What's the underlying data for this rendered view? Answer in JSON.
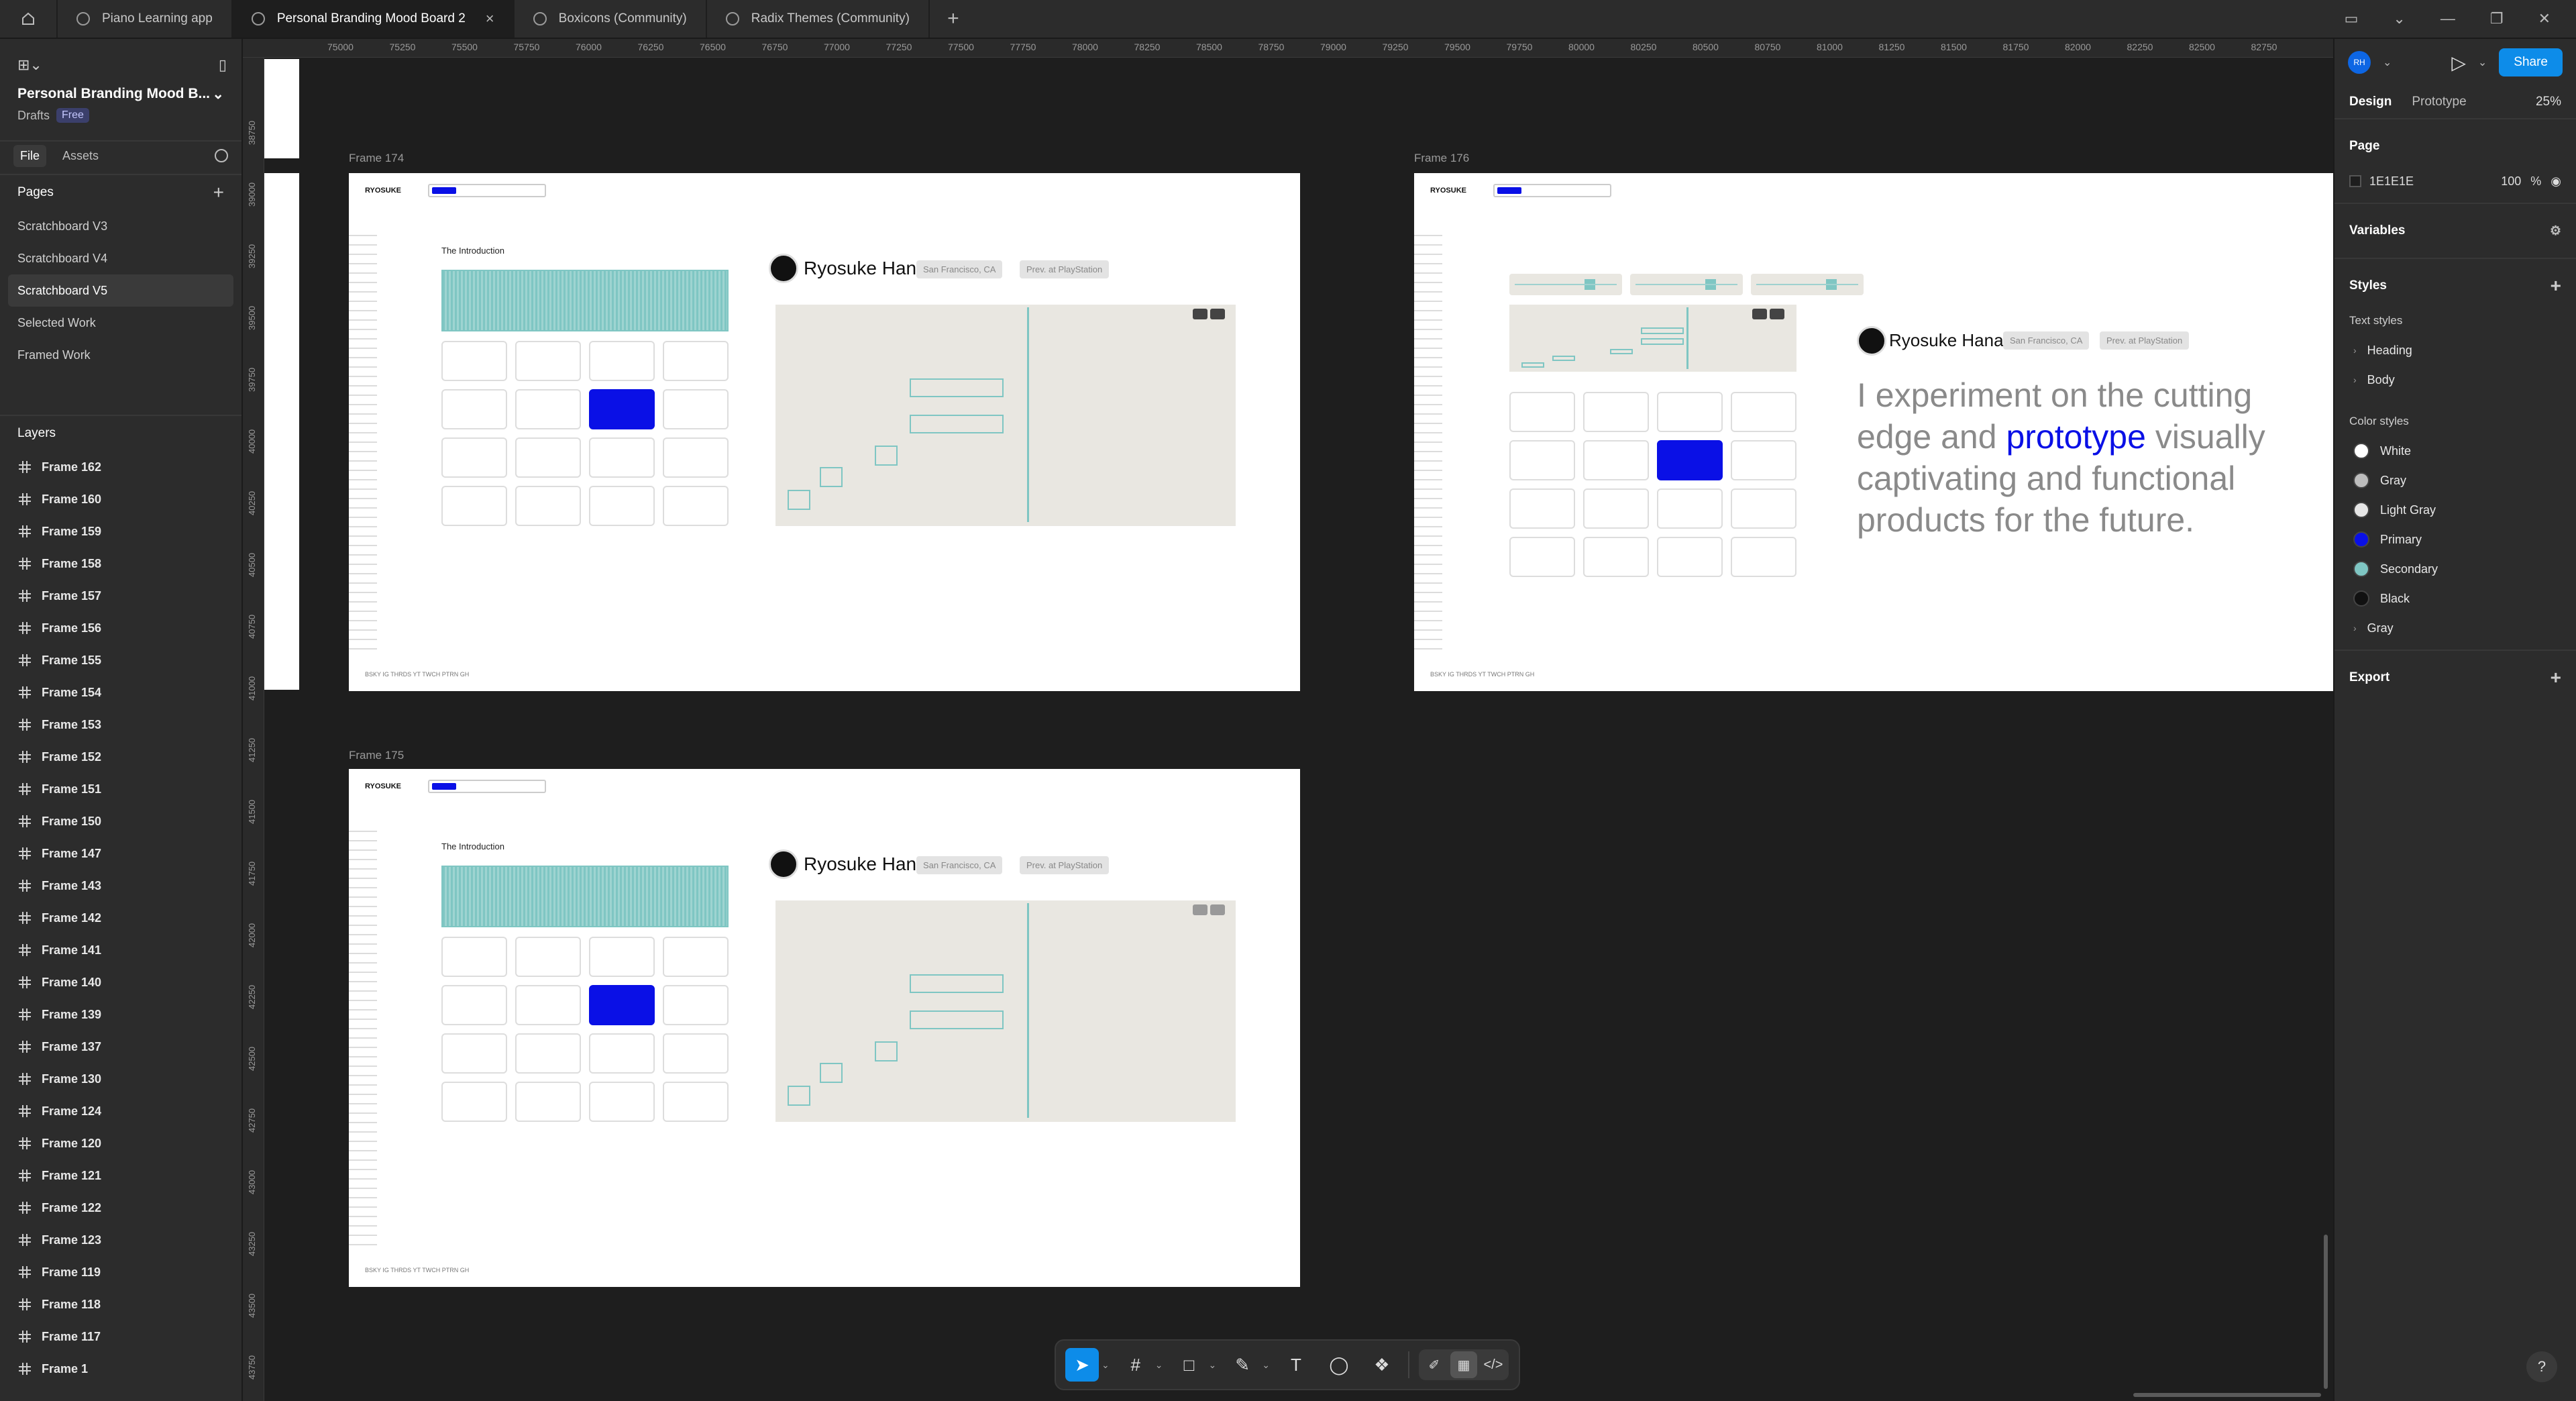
{
  "tabs": [
    {
      "label": "Piano Learning app",
      "active": false
    },
    {
      "label": "Personal Branding Mood Board 2",
      "active": true
    },
    {
      "label": "Boxicons (Community)",
      "active": false
    },
    {
      "label": "Radix Themes (Community)",
      "active": false
    }
  ],
  "left": {
    "file_title": "Personal Branding Mood B...",
    "drafts": "Drafts",
    "plan_badge": "Free",
    "tab_file": "File",
    "tab_assets": "Assets",
    "pages_heading": "Pages",
    "pages": [
      "Scratchboard V3",
      "Scratchboard V4",
      "Scratchboard V5",
      "Selected Work",
      "Framed Work"
    ],
    "active_page": "Scratchboard V5",
    "layers_heading": "Layers",
    "layers": [
      "Frame 162",
      "Frame 160",
      "Frame 159",
      "Frame 158",
      "Frame 157",
      "Frame 156",
      "Frame 155",
      "Frame 154",
      "Frame 153",
      "Frame 152",
      "Frame 151",
      "Frame 150",
      "Frame 147",
      "Frame 143",
      "Frame 142",
      "Frame 141",
      "Frame 140",
      "Frame 139",
      "Frame 137",
      "Frame 130",
      "Frame 124",
      "Frame 120",
      "Frame 121",
      "Frame 122",
      "Frame 123",
      "Frame 119",
      "Frame 118",
      "Frame 117",
      "Frame 1"
    ]
  },
  "ruler": {
    "top": [
      "75000",
      "75250",
      "75500",
      "75750",
      "76000",
      "76250",
      "76500",
      "76750",
      "77000",
      "77250",
      "77500",
      "77750",
      "78000",
      "78250",
      "78500",
      "78750",
      "79000",
      "79250",
      "79500",
      "79750",
      "80000",
      "80250",
      "80500",
      "80750",
      "81000",
      "81250",
      "81500",
      "81750",
      "82000",
      "82250",
      "82500",
      "82750"
    ],
    "left": [
      "38750",
      "39000",
      "39250",
      "39500",
      "39750",
      "40000",
      "40250",
      "40500",
      "40750",
      "41000",
      "41250",
      "41500",
      "41750",
      "42000",
      "42250",
      "42500",
      "42750",
      "43000",
      "43250",
      "43500",
      "43750"
    ]
  },
  "canvas": {
    "frames": [
      {
        "label": "Frame 174"
      },
      {
        "label": "Frame 176"
      },
      {
        "label": "Frame 175"
      }
    ],
    "logo": "RYOSUKE",
    "intro_title": "The Introduction",
    "person_name": "Ryosuke Hana",
    "chip_location": "San Francisco, CA",
    "chip_work": "Prev. at PlayStation",
    "big_text_pre": "I experiment on the cutting edge and ",
    "big_text_highlight": "prototype",
    "big_text_post": " visually captivating and functional products for the future.",
    "footer_links": "BSKY IG THRDS YT TWCH PTRN GH"
  },
  "right": {
    "avatar_initials": "RH",
    "share_label": "Share",
    "tab_design": "Design",
    "tab_prototype": "Prototype",
    "zoom": "25%",
    "page_heading": "Page",
    "page_color": "1E1E1E",
    "page_opacity": "100",
    "page_opacity_unit": "%",
    "variables_heading": "Variables",
    "styles_heading": "Styles",
    "text_styles_heading": "Text styles",
    "text_styles": [
      "Heading",
      "Body"
    ],
    "color_styles_heading": "Color styles",
    "color_styles": [
      {
        "name": "White",
        "color": "#ffffff"
      },
      {
        "name": "Gray",
        "color": "#bdbdbd"
      },
      {
        "name": "Light Gray",
        "color": "#e6e6e6"
      },
      {
        "name": "Primary",
        "color": "#0a10e6"
      },
      {
        "name": "Secondary",
        "color": "#7fc6c3"
      },
      {
        "name": "Black",
        "color": "#111111"
      },
      {
        "name": "Gray",
        "color": null
      }
    ],
    "export_heading": "Export"
  },
  "toolbar": {
    "tools": [
      "move-tool",
      "frame-tool",
      "shape-tool",
      "pen-tool",
      "text-tool",
      "comment-tool",
      "actions-tool"
    ]
  }
}
